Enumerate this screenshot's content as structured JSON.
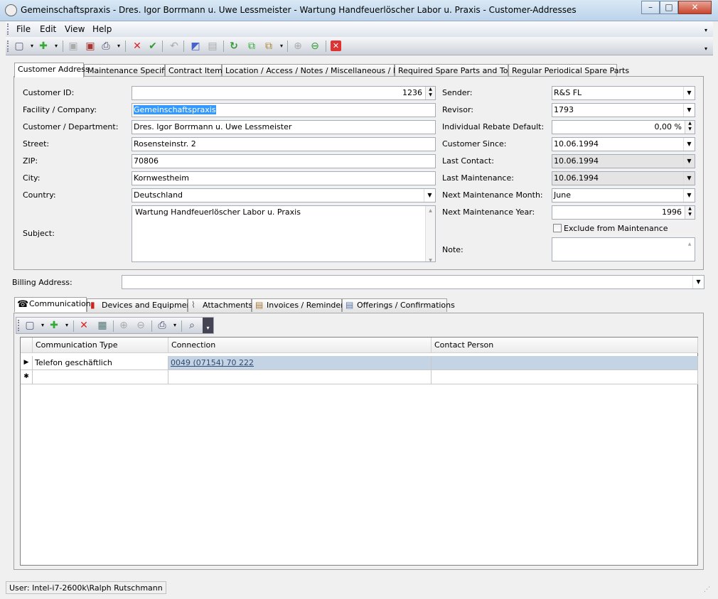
{
  "window": {
    "title": "Gemeinschaftspraxis - Dres. Igor Borrmann u. Uwe Lessmeister - Wartung Handfeuerlöscher Labor u. Praxis - Customer-Addresses"
  },
  "menu": [
    "File",
    "Edit",
    "View",
    "Help"
  ],
  "tabs": [
    "Customer Address",
    "Maintenance Specifics",
    "Contract Items",
    "Location / Access / Notes / Miscellaneous / Photo",
    "Required Spare Parts and Tools",
    "Regular Periodical Spare Parts"
  ],
  "form": {
    "customer_id_label": "Customer ID:",
    "customer_id": "1236",
    "facility_label": "Facility / Company:",
    "facility": "Gemeinschaftspraxis",
    "department_label": "Customer / Department:",
    "department": "Dres. Igor Borrmann u. Uwe Lessmeister",
    "street_label": "Street:",
    "street": "Rosensteinstr. 2",
    "zip_label": "ZIP:",
    "zip": "70806",
    "city_label": "City:",
    "city": "Kornwestheim",
    "country_label": "Country:",
    "country": "Deutschland",
    "subject_label": "Subject:",
    "subject": "Wartung Handfeuerlöscher Labor u. Praxis",
    "sender_label": "Sender:",
    "sender": "R&S FL",
    "revisor_label": "Revisor:",
    "revisor": "1793",
    "rebate_label": "Individual Rebate Default:",
    "rebate": "0,00 %",
    "since_label": "Customer Since:",
    "since": "10.06.1994",
    "last_contact_label": "Last Contact:",
    "last_contact": "10.06.1994",
    "last_maint_label": "Last Maintenance:",
    "last_maint": "10.06.1994",
    "next_month_label": "Next Maintenance Month:",
    "next_month": "June",
    "next_year_label": "Next Maintenance Year:",
    "next_year": "1996",
    "exclude_label": "Exclude from Maintenance",
    "note_label": "Note:",
    "billing_label": "Billing Address:"
  },
  "bottom_tabs": [
    "Communication",
    "Devices and Equipments",
    "Attachments",
    "Invoices / Reminders",
    "Offerings / Confirmations"
  ],
  "grid": {
    "columns": [
      "Communication Type",
      "Connection",
      "Contact Person"
    ],
    "rows": [
      {
        "type": "Telefon geschäftlich",
        "connection": "0049 (07154) 70 222",
        "contact": ""
      }
    ]
  },
  "status": {
    "user": "User: Intel-i7-2600k\\Ralph Rutschmann"
  }
}
